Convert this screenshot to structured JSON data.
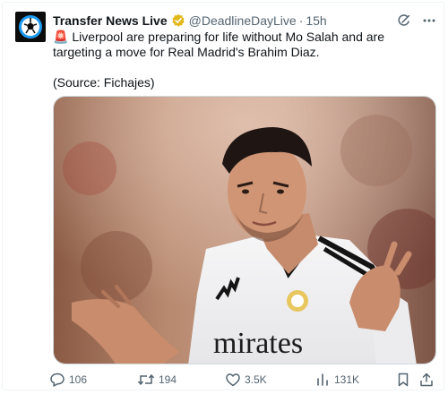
{
  "post": {
    "author_name": "Transfer News Live",
    "author_handle": "@DeadlineDayLive",
    "separator": "·",
    "time_ago": "15h",
    "emoji": "🚨",
    "body_text": "Liverpool are preparing for life without Mo Salah and are targeting a move for Real Madrid's Brahim Diaz.",
    "source_text": "(Source: Fichajes)",
    "media_text": "mirates"
  },
  "actions": {
    "replies": "106",
    "reposts": "194",
    "likes": "3.5K",
    "views": "131K"
  },
  "icons": {
    "avatar": "football-logo-icon",
    "verified": "verified-badge-icon",
    "grok": "grok-icon",
    "more": "more-icon",
    "reply": "reply-icon",
    "repost": "repost-icon",
    "like": "like-icon",
    "views": "views-icon",
    "bookmark": "bookmark-icon",
    "share": "share-icon"
  },
  "colors": {
    "text": "#0f1419",
    "secondary": "#536471",
    "gold_badge": "#e2b719",
    "avatar_blue": "#1d9bf0"
  }
}
